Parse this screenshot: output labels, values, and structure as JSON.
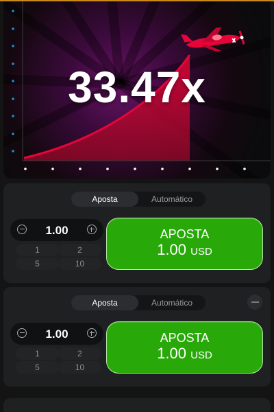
{
  "game": {
    "multiplier": "33.47x"
  },
  "panels": [
    {
      "tabs": [
        {
          "label": "Aposta",
          "active": true
        },
        {
          "label": "Automático",
          "active": false
        }
      ],
      "amount": "1.00",
      "quick": [
        "1",
        "2",
        "5",
        "10"
      ],
      "bet_label": "APOSTA",
      "bet_amount": "1.00",
      "currency": "USD"
    },
    {
      "tabs": [
        {
          "label": "Aposta",
          "active": true
        },
        {
          "label": "Automático",
          "active": false
        }
      ],
      "amount": "1.00",
      "quick": [
        "1",
        "2",
        "5",
        "10"
      ],
      "bet_label": "APOSTA",
      "bet_amount": "1.00",
      "currency": "USD"
    }
  ],
  "colors": {
    "accent_green": "#28a909",
    "curve_red": "#e50539",
    "top_line": "#c98a19",
    "axis_dots": "#1d8fd6"
  },
  "icons": [
    "airplane-icon",
    "minus-circle-icon",
    "plus-circle-icon",
    "remove-bet-icon"
  ]
}
